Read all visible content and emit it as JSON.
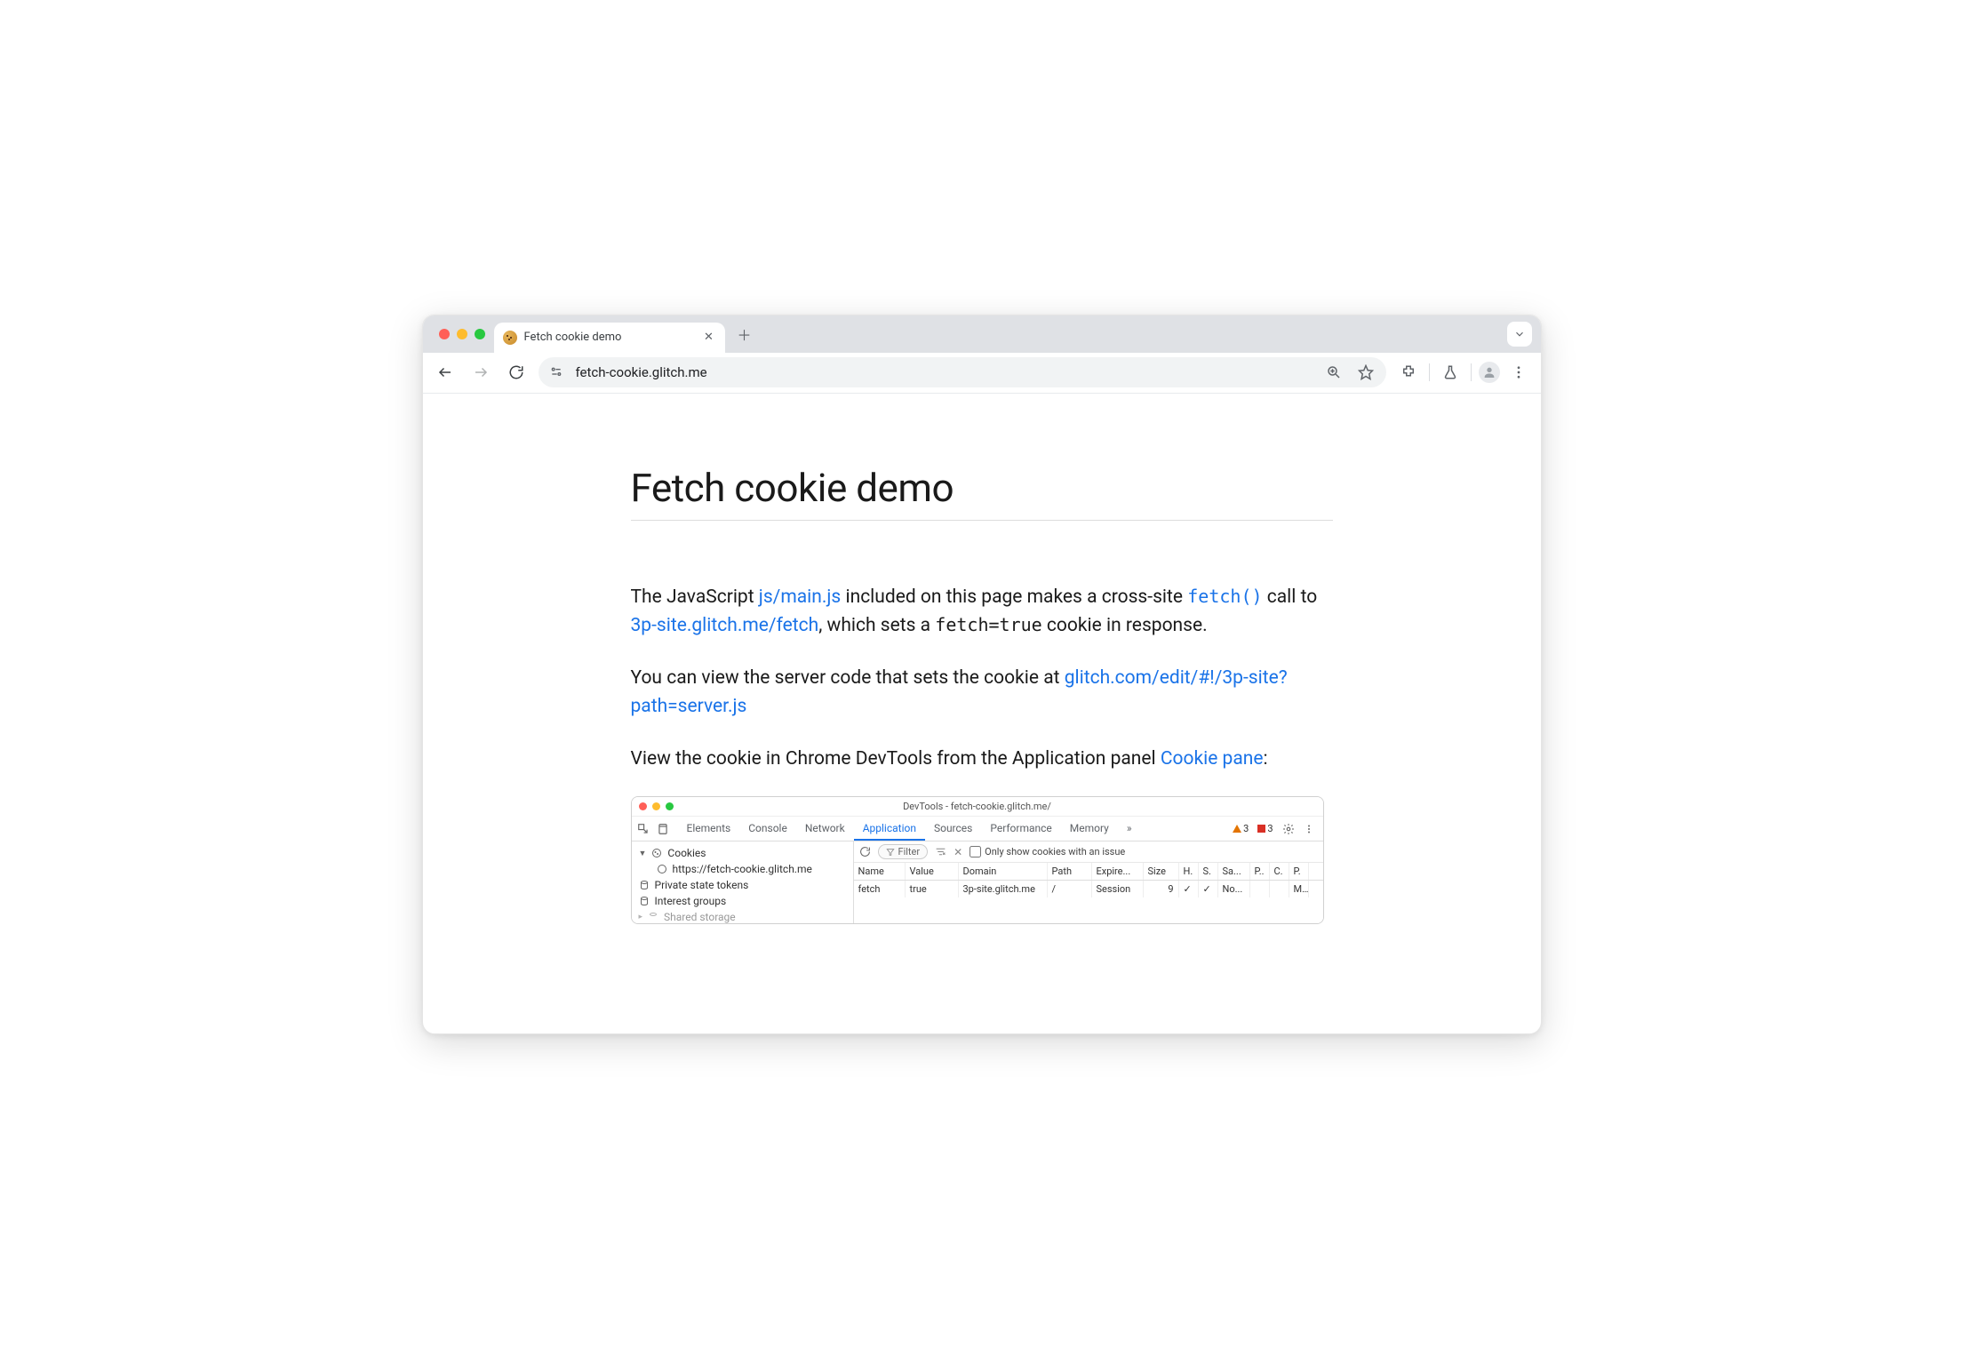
{
  "browser": {
    "tab_title": "Fetch cookie demo",
    "url": "fetch-cookie.glitch.me"
  },
  "page": {
    "h1": "Fetch cookie demo",
    "p1_a": "The JavaScript ",
    "p1_link1": "js/main.js",
    "p1_b": " included on this page makes a cross-site ",
    "p1_code": "fetch()",
    "p1_c": " call to ",
    "p1_link2": "3p-site.glitch.me/fetch",
    "p1_d": ", which sets a ",
    "p1_code2": "fetch=true",
    "p1_e": " cookie in response.",
    "p2_a": "You can view the server code that sets the cookie at ",
    "p2_link": "glitch.com/edit/#!/3p-site?path=server.js",
    "p3_a": "View the cookie in Chrome DevTools from the Application panel ",
    "p3_link": "Cookie pane",
    "p3_b": ":"
  },
  "devtools": {
    "title": "DevTools - fetch-cookie.glitch.me/",
    "tabs": [
      "Elements",
      "Console",
      "Network",
      "Application",
      "Sources",
      "Performance",
      "Memory"
    ],
    "active_tab": "Application",
    "warn_count": "3",
    "err_count": "3",
    "sidebar": {
      "cookies": "Cookies",
      "cookie_origin": "https://fetch-cookie.glitch.me",
      "pst": "Private state tokens",
      "ig": "Interest groups",
      "ss": "Shared storage"
    },
    "filter_placeholder": "Filter",
    "only_issue": "Only show cookies with an issue",
    "columns": [
      "Name",
      "Value",
      "Domain",
      "Path",
      "Expire...",
      "Size",
      "H.",
      "S.",
      "Sa...",
      "P..",
      "C.",
      "P."
    ],
    "row": {
      "name": "fetch",
      "value": "true",
      "domain": "3p-site.glitch.me",
      "path": "/",
      "expires": "Session",
      "size": "9",
      "http": "✓",
      "secure": "✓",
      "samesite": "No...",
      "pkey": "",
      "cross": "",
      "priority": "M.."
    }
  }
}
